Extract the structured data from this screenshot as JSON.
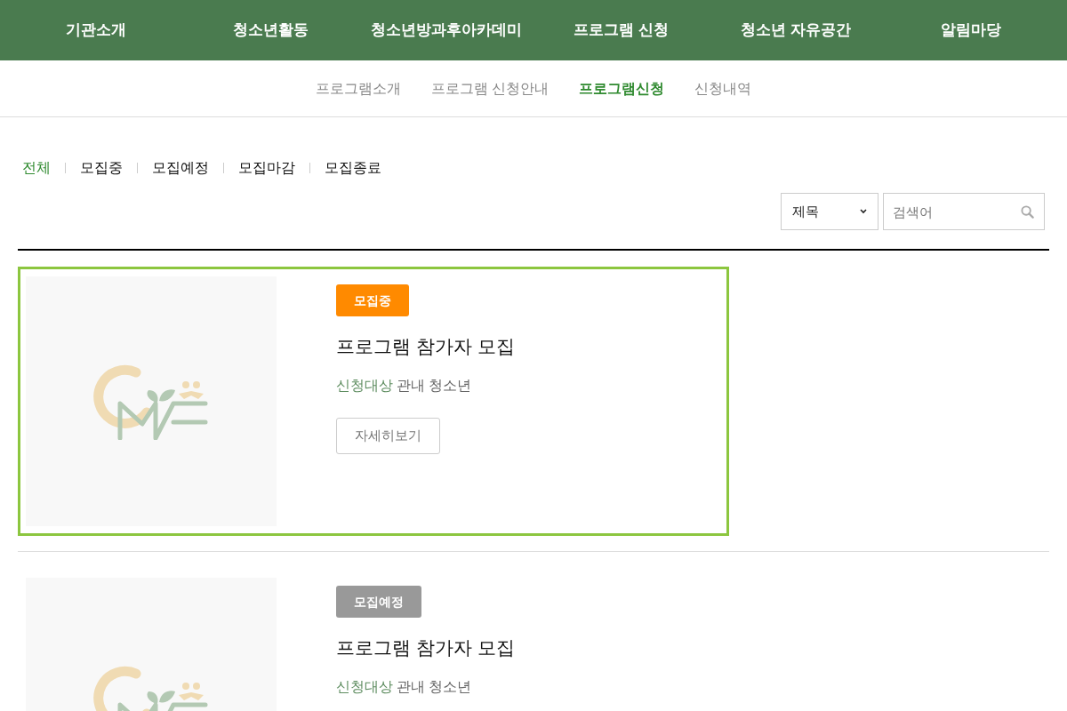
{
  "main_nav": [
    {
      "label": "기관소개"
    },
    {
      "label": "청소년활동"
    },
    {
      "label": "청소년방과후아카데미"
    },
    {
      "label": "프로그램 신청"
    },
    {
      "label": "청소년 자유공간"
    },
    {
      "label": "알림마당"
    }
  ],
  "sub_nav": [
    {
      "label": "프로그램소개",
      "selected": false
    },
    {
      "label": "프로그램 신청안내",
      "selected": false
    },
    {
      "label": "프로그램신청",
      "selected": true
    },
    {
      "label": "신청내역",
      "selected": false
    }
  ],
  "filters": [
    {
      "label": "전체",
      "selected": true
    },
    {
      "label": "모집중",
      "selected": false
    },
    {
      "label": "모집예정",
      "selected": false
    },
    {
      "label": "모집마감",
      "selected": false
    },
    {
      "label": "모집종료",
      "selected": false
    }
  ],
  "search": {
    "category": "제목",
    "placeholder": "검색어"
  },
  "programs": [
    {
      "status": "모집중",
      "color": "#ff8a00",
      "title": "프로그램 참가자 모집",
      "target_label": "신청대상",
      "target": "관내 청소년",
      "button": "자세히보기",
      "selected": true
    },
    {
      "status": "모집예정",
      "color": "#999999",
      "title": "프로그램 참가자 모집",
      "target_label": "신청대상",
      "target": "관내 청소년",
      "selected": false
    }
  ]
}
